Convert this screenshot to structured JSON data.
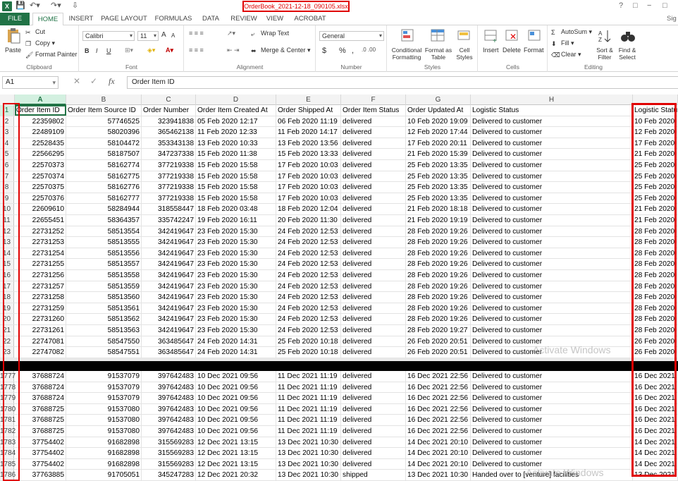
{
  "window": {
    "title": "OrderBook_2021-12-18_090105.xlsx",
    "help": "?",
    "min": "−",
    "restore": "□",
    "close": "✕",
    "signin": "Sig"
  },
  "tabs": [
    "FILE",
    "HOME",
    "INSERT",
    "PAGE LAYOUT",
    "FORMULAS",
    "DATA",
    "REVIEW",
    "VIEW",
    "ACROBAT"
  ],
  "ribbon": {
    "clipboard": {
      "label": "Clipboard",
      "paste": "Paste",
      "cut": "Cut",
      "copy": "Copy",
      "format_painter": "Format Painter"
    },
    "font": {
      "label": "Font",
      "name": "Calibri",
      "size": "11",
      "bold": "B",
      "italic": "I",
      "underline": "U",
      "grow": "A",
      "shrink": "A"
    },
    "alignment": {
      "label": "Alignment",
      "wrap": "Wrap Text",
      "merge": "Merge & Center"
    },
    "number": {
      "label": "Number",
      "format": "General",
      "currency": "$",
      "percent": "%",
      "comma": ","
    },
    "styles": {
      "label": "Styles",
      "conditional": "Conditional Formatting",
      "format_table": "Format as Table",
      "cell_styles": "Cell Styles"
    },
    "cells": {
      "label": "Cells",
      "insert": "Insert",
      "delete": "Delete",
      "format": "Format"
    },
    "editing": {
      "label": "Editing",
      "autosum": "AutoSum",
      "fill": "Fill",
      "clear": "Clear",
      "sort": "Sort & Filter",
      "find": "Find & Select"
    }
  },
  "formula_bar": {
    "name_box": "A1",
    "fx": "fx",
    "content": "Order Item ID"
  },
  "columns": [
    "A",
    "B",
    "C",
    "D",
    "E",
    "F",
    "G",
    "H"
  ],
  "headers": [
    "Order Item ID",
    "Order Item Source ID",
    "Order Number",
    "Order Item Created At",
    "Order Shipped At",
    "Order Item Status",
    "Order Updated At",
    "Logistic Status",
    "Logistic Status"
  ],
  "rows_top": [
    [
      "2",
      "22359802",
      "57746525",
      "323941838",
      "05 Feb 2020 12:17",
      "06 Feb 2020 11:19",
      "delivered",
      "10 Feb 2020 19:09",
      "Delivered to customer",
      "10 Feb 2020"
    ],
    [
      "3",
      "22489109",
      "58020396",
      "365462138",
      "11 Feb 2020 12:33",
      "11 Feb 2020 14:17",
      "delivered",
      "12 Feb 2020 17:44",
      "Delivered to customer",
      "12 Feb 2020"
    ],
    [
      "4",
      "22528435",
      "58104472",
      "353343138",
      "13 Feb 2020 10:33",
      "13 Feb 2020 13:56",
      "delivered",
      "17 Feb 2020 20:11",
      "Delivered to customer",
      "17 Feb 2020"
    ],
    [
      "5",
      "22566295",
      "58187507",
      "347237338",
      "15 Feb 2020 11:38",
      "15 Feb 2020 13:33",
      "delivered",
      "21 Feb 2020 15:39",
      "Delivered to customer",
      "21 Feb 2020"
    ],
    [
      "6",
      "22570373",
      "58162774",
      "377219338",
      "15 Feb 2020 15:58",
      "17 Feb 2020 10:03",
      "delivered",
      "25 Feb 2020 13:35",
      "Delivered to customer",
      "25 Feb 2020"
    ],
    [
      "7",
      "22570374",
      "58162775",
      "377219338",
      "15 Feb 2020 15:58",
      "17 Feb 2020 10:03",
      "delivered",
      "25 Feb 2020 13:35",
      "Delivered to customer",
      "25 Feb 2020"
    ],
    [
      "8",
      "22570375",
      "58162776",
      "377219338",
      "15 Feb 2020 15:58",
      "17 Feb 2020 10:03",
      "delivered",
      "25 Feb 2020 13:35",
      "Delivered to customer",
      "25 Feb 2020"
    ],
    [
      "9",
      "22570376",
      "58162777",
      "377219338",
      "15 Feb 2020 15:58",
      "17 Feb 2020 10:03",
      "delivered",
      "25 Feb 2020 13:35",
      "Delivered to customer",
      "25 Feb 2020"
    ],
    [
      "10",
      "22609610",
      "58284944",
      "318558447",
      "18 Feb 2020 03:48",
      "18 Feb 2020 12:04",
      "delivered",
      "21 Feb 2020 18:18",
      "Delivered to customer",
      "21 Feb 2020"
    ],
    [
      "11",
      "22655451",
      "58364357",
      "335742247",
      "19 Feb 2020 16:11",
      "20 Feb 2020 11:30",
      "delivered",
      "21 Feb 2020 19:19",
      "Delivered to customer",
      "21 Feb 2020"
    ],
    [
      "12",
      "22731252",
      "58513554",
      "342419647",
      "23 Feb 2020 15:30",
      "24 Feb 2020 12:53",
      "delivered",
      "28 Feb 2020 19:26",
      "Delivered to customer",
      "28 Feb 2020"
    ],
    [
      "13",
      "22731253",
      "58513555",
      "342419647",
      "23 Feb 2020 15:30",
      "24 Feb 2020 12:53",
      "delivered",
      "28 Feb 2020 19:26",
      "Delivered to customer",
      "28 Feb 2020"
    ],
    [
      "14",
      "22731254",
      "58513556",
      "342419647",
      "23 Feb 2020 15:30",
      "24 Feb 2020 12:53",
      "delivered",
      "28 Feb 2020 19:26",
      "Delivered to customer",
      "28 Feb 2020"
    ],
    [
      "15",
      "22731255",
      "58513557",
      "342419647",
      "23 Feb 2020 15:30",
      "24 Feb 2020 12:53",
      "delivered",
      "28 Feb 2020 19:26",
      "Delivered to customer",
      "28 Feb 2020"
    ],
    [
      "16",
      "22731256",
      "58513558",
      "342419647",
      "23 Feb 2020 15:30",
      "24 Feb 2020 12:53",
      "delivered",
      "28 Feb 2020 19:26",
      "Delivered to customer",
      "28 Feb 2020"
    ],
    [
      "17",
      "22731257",
      "58513559",
      "342419647",
      "23 Feb 2020 15:30",
      "24 Feb 2020 12:53",
      "delivered",
      "28 Feb 2020 19:26",
      "Delivered to customer",
      "28 Feb 2020"
    ],
    [
      "18",
      "22731258",
      "58513560",
      "342419647",
      "23 Feb 2020 15:30",
      "24 Feb 2020 12:53",
      "delivered",
      "28 Feb 2020 19:26",
      "Delivered to customer",
      "28 Feb 2020"
    ],
    [
      "19",
      "22731259",
      "58513561",
      "342419647",
      "23 Feb 2020 15:30",
      "24 Feb 2020 12:53",
      "delivered",
      "28 Feb 2020 19:26",
      "Delivered to customer",
      "28 Feb 2020"
    ],
    [
      "20",
      "22731260",
      "58513562",
      "342419647",
      "23 Feb 2020 15:30",
      "24 Feb 2020 12:53",
      "delivered",
      "28 Feb 2020 19:26",
      "Delivered to customer",
      "28 Feb 2020"
    ],
    [
      "21",
      "22731261",
      "58513563",
      "342419647",
      "23 Feb 2020 15:30",
      "24 Feb 2020 12:53",
      "delivered",
      "28 Feb 2020 19:27",
      "Delivered to customer",
      "28 Feb 2020"
    ],
    [
      "22",
      "22747081",
      "58547550",
      "363485647",
      "24 Feb 2020 14:31",
      "25 Feb 2020 10:18",
      "delivered",
      "26 Feb 2020 20:51",
      "Delivered to customer",
      "26 Feb 2020"
    ],
    [
      "23",
      "22747082",
      "58547551",
      "363485647",
      "24 Feb 2020 14:31",
      "25 Feb 2020 10:18",
      "delivered",
      "26 Feb 2020 20:51",
      "Delivered to customer",
      "26 Feb 2020"
    ]
  ],
  "rows_bottom": [
    [
      "1777",
      "37688724",
      "91537079",
      "397642483",
      "10 Dec 2021 09:56",
      "11 Dec 2021 11:19",
      "delivered",
      "16 Dec 2021 22:56",
      "Delivered to customer",
      "16 Dec 2021"
    ],
    [
      "1778",
      "37688724",
      "91537079",
      "397642483",
      "10 Dec 2021 09:56",
      "11 Dec 2021 11:19",
      "delivered",
      "16 Dec 2021 22:56",
      "Delivered to customer",
      "16 Dec 2021"
    ],
    [
      "1779",
      "37688724",
      "91537079",
      "397642483",
      "10 Dec 2021 09:56",
      "11 Dec 2021 11:19",
      "delivered",
      "16 Dec 2021 22:56",
      "Delivered to customer",
      "16 Dec 2021"
    ],
    [
      "1780",
      "37688725",
      "91537080",
      "397642483",
      "10 Dec 2021 09:56",
      "11 Dec 2021 11:19",
      "delivered",
      "16 Dec 2021 22:56",
      "Delivered to customer",
      "16 Dec 2021"
    ],
    [
      "1781",
      "37688725",
      "91537080",
      "397642483",
      "10 Dec 2021 09:56",
      "11 Dec 2021 11:19",
      "delivered",
      "16 Dec 2021 22:56",
      "Delivered to customer",
      "16 Dec 2021"
    ],
    [
      "1782",
      "37688725",
      "91537080",
      "397642483",
      "10 Dec 2021 09:56",
      "11 Dec 2021 11:19",
      "delivered",
      "16 Dec 2021 22:56",
      "Delivered to customer",
      "16 Dec 2021"
    ],
    [
      "1783",
      "37754402",
      "91682898",
      "315569283",
      "12 Dec 2021 13:15",
      "13 Dec 2021 10:30",
      "delivered",
      "14 Dec 2021 20:10",
      "Delivered to customer",
      "14 Dec 2021"
    ],
    [
      "1784",
      "37754402",
      "91682898",
      "315569283",
      "12 Dec 2021 13:15",
      "13 Dec 2021 10:30",
      "delivered",
      "14 Dec 2021 20:10",
      "Delivered to customer",
      "14 Dec 2021"
    ],
    [
      "1785",
      "37754402",
      "91682898",
      "315569283",
      "12 Dec 2021 13:15",
      "13 Dec 2021 10:30",
      "delivered",
      "14 Dec 2021 20:10",
      "Delivered to customer",
      "14 Dec 2021"
    ],
    [
      "1786",
      "37763885",
      "91705051",
      "345247283",
      "12 Dec 2021 20:32",
      "13 Dec 2021 10:30",
      "shipped",
      "13 Dec 2021 10:30",
      "Handed over to [venture] facilities",
      "13 Dec 2021"
    ]
  ],
  "watermark": "Activate Windows",
  "colors": {
    "excel_green": "#217346",
    "highlight_red": "#e00000"
  }
}
